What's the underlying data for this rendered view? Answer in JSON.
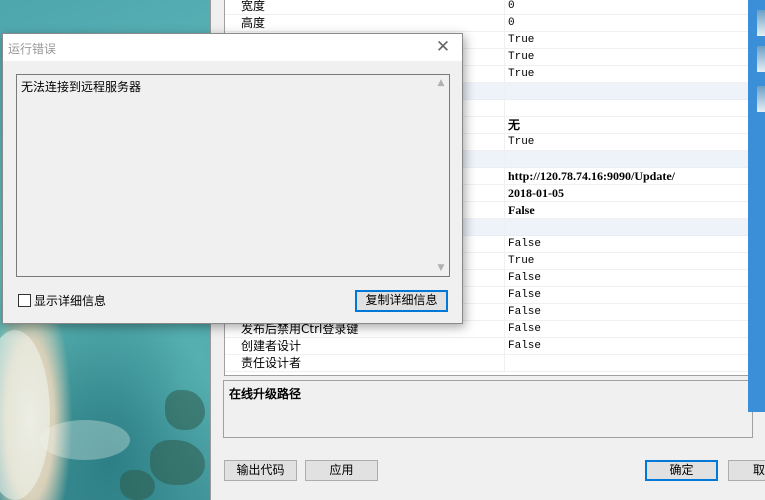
{
  "dialog": {
    "title": "运行错误",
    "message": "无法连接到远程服务器",
    "show_details_label": "显示详细信息",
    "copy_details_label": "复制详细信息"
  },
  "properties": {
    "rows": [
      {
        "name": "宽度",
        "value": "0",
        "category": false,
        "bold": false
      },
      {
        "name": "高度",
        "value": "0",
        "category": false,
        "bold": false
      },
      {
        "name": "",
        "value": "True",
        "category": false,
        "bold": false
      },
      {
        "name": "",
        "value": "True",
        "category": false,
        "bold": false
      },
      {
        "name": "",
        "value": "True",
        "category": false,
        "bold": false
      },
      {
        "name": "",
        "value": "",
        "category": true,
        "bold": false
      },
      {
        "name": "",
        "value": "",
        "category": false,
        "bold": false
      },
      {
        "name": "",
        "value": "无",
        "category": false,
        "bold": true
      },
      {
        "name": "",
        "value": "True",
        "category": false,
        "bold": false
      },
      {
        "name": "",
        "value": "",
        "category": true,
        "bold": false
      },
      {
        "name": "",
        "value": "http://120.78.74.16:9090/Update/",
        "category": false,
        "bold": true
      },
      {
        "name": "",
        "value": "2018-01-05",
        "category": false,
        "bold": true
      },
      {
        "name": "",
        "value": "False",
        "category": false,
        "bold": true
      },
      {
        "name": "",
        "value": "",
        "category": true,
        "bold": false
      },
      {
        "name": "",
        "value": "False",
        "category": false,
        "bold": false
      },
      {
        "name": "",
        "value": "True",
        "category": false,
        "bold": false
      },
      {
        "name": "",
        "value": "False",
        "category": false,
        "bold": false
      },
      {
        "name": "",
        "value": "False",
        "category": false,
        "bold": false
      },
      {
        "name": "",
        "value": "False",
        "category": false,
        "bold": false
      },
      {
        "name": "发布后禁用Ctrl登录键",
        "value": "False",
        "category": false,
        "bold": false
      },
      {
        "name": "创建者设计",
        "value": "False",
        "category": false,
        "bold": false
      },
      {
        "name": "责任设计者",
        "value": "",
        "category": false,
        "bold": false
      }
    ]
  },
  "description": {
    "title": "在线升级路径"
  },
  "buttons": {
    "export_code": "输出代码",
    "apply": "应用",
    "ok": "确定",
    "cancel": "取"
  },
  "colors": {
    "accent": "#0078d7",
    "category_row": "#eef3fa",
    "side_panel": "#3b8fd8"
  }
}
